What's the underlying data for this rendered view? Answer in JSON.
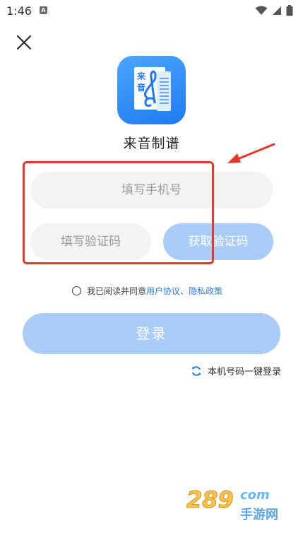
{
  "status": {
    "time": "1:46",
    "app_badge": "A"
  },
  "app": {
    "name": "来音制谱",
    "logo_text_1": "来",
    "logo_text_2": "音"
  },
  "form": {
    "phone_placeholder": "填写手机号",
    "code_placeholder": "填写验证码",
    "get_code_label": "获取验证码",
    "login_label": "登录"
  },
  "agreement": {
    "prefix": "我已阅读并同意",
    "user_agreement": "用户协议",
    "separator": "、",
    "privacy_policy": "隐私政策"
  },
  "one_key_login": "本机号码一键登录",
  "watermark": {
    "text_1": "289",
    "text_2": "com",
    "text_3": "手游网"
  },
  "colors": {
    "accent": "#1e7bf0",
    "button_disabled": "#a9cbf8",
    "link": "#2a7be4",
    "highlight": "#e23a2c",
    "input_bg": "#f3f3f3"
  },
  "icons": [
    "close-icon",
    "wifi-icon",
    "signal-icon",
    "battery-icon",
    "refresh-icon",
    "treble-clef-icon"
  ]
}
